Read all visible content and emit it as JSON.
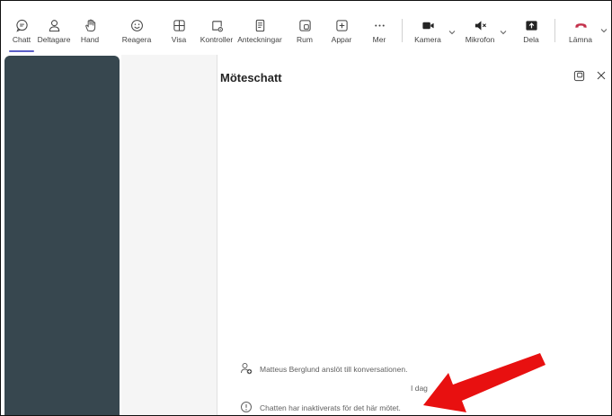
{
  "toolbar": {
    "items": [
      {
        "label": "Chatt",
        "icon": "chat-icon"
      },
      {
        "label": "Deltagare",
        "icon": "people-icon"
      },
      {
        "label": "Hand",
        "icon": "hand-icon"
      },
      {
        "label": "Reagera",
        "icon": "emoji-icon"
      },
      {
        "label": "Visa",
        "icon": "grid-icon"
      },
      {
        "label": "Kontroller",
        "icon": "controls-icon"
      },
      {
        "label": "Anteckningar",
        "icon": "notes-icon"
      },
      {
        "label": "Rum",
        "icon": "rooms-icon"
      },
      {
        "label": "Appar",
        "icon": "apps-icon"
      },
      {
        "label": "Mer",
        "icon": "more-icon"
      },
      {
        "label": "Kamera",
        "icon": "camera-icon"
      },
      {
        "label": "Mikrofon",
        "icon": "microphone-muted-icon"
      },
      {
        "label": "Dela",
        "icon": "share-icon"
      },
      {
        "label": "Lämna",
        "icon": "hang-up-icon"
      }
    ]
  },
  "chat": {
    "title": "Möteschatt",
    "join_message": "Matteus Berglund anslöt till konversationen.",
    "timestamp": "I dag",
    "disabled_message": "Chatten har inaktiverats för det här mötet."
  },
  "colors": {
    "accent": "#5b5fc7",
    "video_panel": "#37474f",
    "hang_up": "#c4314b",
    "annotation_arrow": "#e81010"
  }
}
